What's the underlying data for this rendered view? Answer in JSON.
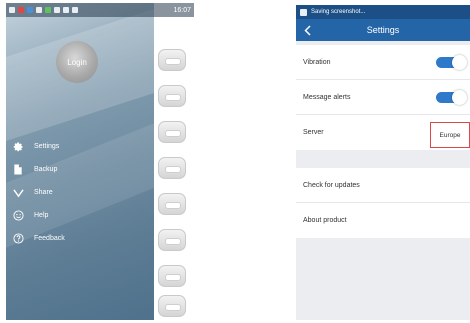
{
  "left_screen": {
    "status_bar": {
      "time": "16:07"
    },
    "login_label": "Login",
    "menu": [
      {
        "label": "Settings",
        "icon": "gear-icon"
      },
      {
        "label": "Backup",
        "icon": "file-icon"
      },
      {
        "label": "Share",
        "icon": "share-icon"
      },
      {
        "label": "Help",
        "icon": "help-icon"
      },
      {
        "label": "Feedback",
        "icon": "feedback-icon"
      }
    ]
  },
  "right_screen": {
    "status_bar": {
      "text": "Saving screenshot..."
    },
    "title": "Settings",
    "rows": {
      "vibration": "Vibration",
      "message_alerts": "Message alerts",
      "server": "Server",
      "server_value": "Europe",
      "check_updates": "Check for updates",
      "about": "About product"
    }
  },
  "colors": {
    "accent": "#2465a8",
    "status_bar": "#1b4f86",
    "toggle_on": "#2e79c9",
    "highlight": "#d84a4a"
  }
}
